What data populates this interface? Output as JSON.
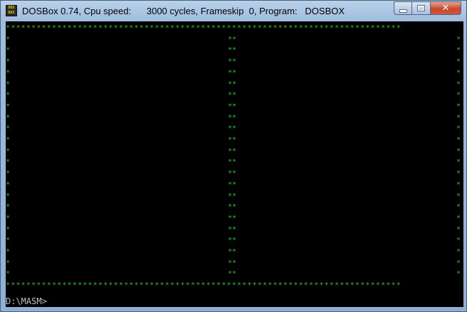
{
  "window": {
    "title": "DOSBox 0.74, Cpu speed:      3000 cycles, Frameskip  0, Program:   DOSBOX",
    "icon_name": "dosbox-icon",
    "icon_lines": [
      "DOS",
      "BOX"
    ]
  },
  "caption_buttons": {
    "close_glyph": "✕"
  },
  "screen": {
    "background": "#000000",
    "star_color": "#2fbf2f",
    "star_char": "*",
    "double_star": "**",
    "border_line": "*****************************************************************************",
    "row_count": 22,
    "prompt": "D:\\MASM>"
  }
}
